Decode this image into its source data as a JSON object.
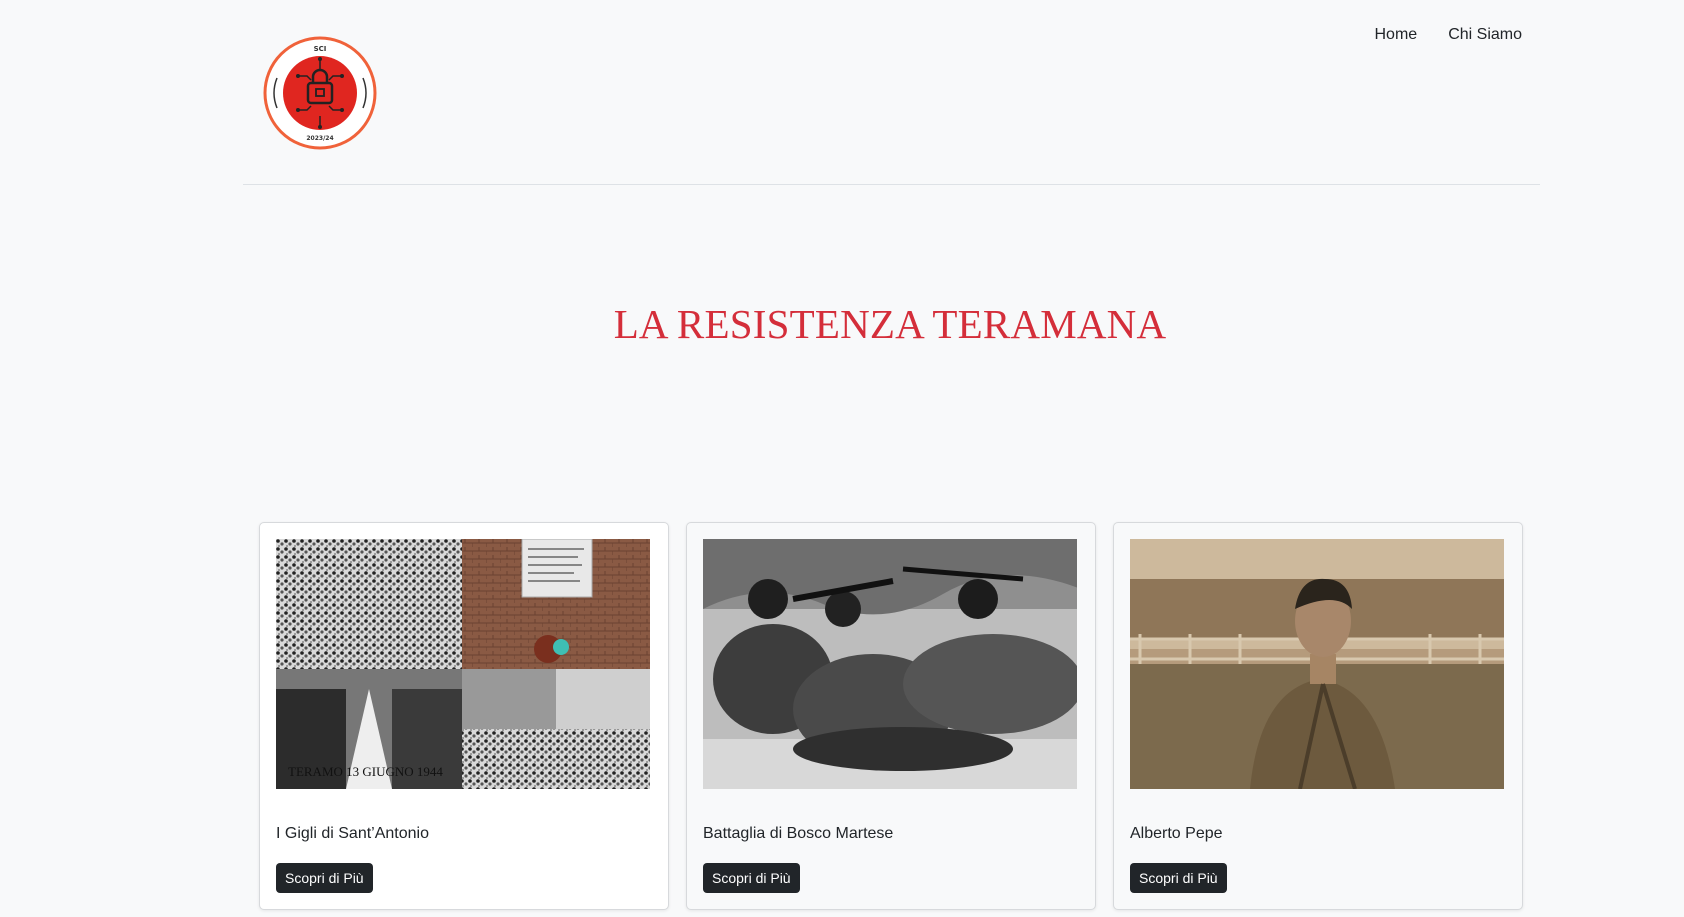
{
  "header": {
    "logo_text_top": "SCI",
    "logo_text_bottom": "2023/24",
    "nav": [
      {
        "label": "Home"
      },
      {
        "label": "Chi Siamo"
      }
    ]
  },
  "hero": {
    "title": "LA RESISTENZA TERAMANA"
  },
  "cards": [
    {
      "title": "I Gigli di Sant’Antonio",
      "button": "Scopri di Più",
      "image_caption": "TERAMO 13 GIUGNO 1944"
    },
    {
      "title": "Battaglia di Bosco Martese",
      "button": "Scopri di Più"
    },
    {
      "title": "Alberto Pepe",
      "button": "Scopri di Più"
    }
  ],
  "colors": {
    "accent": "#d42e3a",
    "background": "#f8f9fa",
    "button": "#212529"
  }
}
